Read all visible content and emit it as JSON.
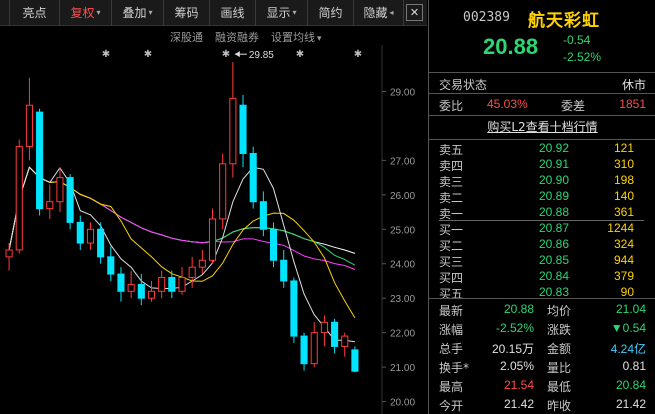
{
  "toolbar": {
    "items": [
      {
        "label": "亮点",
        "caret": ""
      },
      {
        "label": "复权",
        "caret": "▾",
        "active": true
      },
      {
        "label": "叠加",
        "caret": "▾"
      },
      {
        "label": "筹码",
        "caret": ""
      },
      {
        "label": "画线",
        "caret": ""
      },
      {
        "label": "显示",
        "caret": "▾"
      },
      {
        "label": "简约",
        "caret": ""
      },
      {
        "label": "隐藏",
        "caret": "◂"
      }
    ],
    "close_label": "✕"
  },
  "chart_subbar": {
    "shenzhen_connect": "深股通",
    "margin_trading": "融资融券",
    "ma_settings": "设置均线",
    "ma_settings_caret": "▾"
  },
  "chart_data": {
    "type": "candlestick",
    "y_tick_labels": [
      "29.00",
      "27.00",
      "26.00",
      "25.00",
      "24.00",
      "23.00",
      "22.00",
      "21.00",
      "20.00"
    ],
    "high_annotation": "29.85",
    "colors": {
      "up": "#ff3b3b",
      "down": "#00e5ff",
      "ma5": "#e0e0e0",
      "ma10": "#ffd200",
      "ma20": "#ff3bff",
      "ma30": "#2ed573",
      "ma60": "#ffffff"
    },
    "candles": [
      {
        "o": 24.2,
        "h": 24.6,
        "l": 23.8,
        "c": 24.4
      },
      {
        "o": 24.4,
        "h": 27.6,
        "l": 24.3,
        "c": 27.4
      },
      {
        "o": 27.4,
        "h": 29.4,
        "l": 27.0,
        "c": 28.6
      },
      {
        "o": 28.4,
        "h": 28.5,
        "l": 25.4,
        "c": 25.6
      },
      {
        "o": 25.6,
        "h": 26.3,
        "l": 25.3,
        "c": 25.8
      },
      {
        "o": 25.8,
        "h": 26.8,
        "l": 25.5,
        "c": 26.5
      },
      {
        "o": 26.5,
        "h": 26.6,
        "l": 25.0,
        "c": 25.2
      },
      {
        "o": 25.2,
        "h": 25.4,
        "l": 24.4,
        "c": 24.6
      },
      {
        "o": 24.6,
        "h": 25.2,
        "l": 24.4,
        "c": 25.0
      },
      {
        "o": 25.0,
        "h": 25.2,
        "l": 24.0,
        "c": 24.2
      },
      {
        "o": 24.2,
        "h": 24.5,
        "l": 23.5,
        "c": 23.7
      },
      {
        "o": 23.7,
        "h": 23.9,
        "l": 22.9,
        "c": 23.2
      },
      {
        "o": 23.2,
        "h": 23.8,
        "l": 23.0,
        "c": 23.4
      },
      {
        "o": 23.4,
        "h": 23.7,
        "l": 22.8,
        "c": 23.0
      },
      {
        "o": 23.0,
        "h": 23.5,
        "l": 22.9,
        "c": 23.2
      },
      {
        "o": 23.2,
        "h": 23.8,
        "l": 23.0,
        "c": 23.6
      },
      {
        "o": 23.6,
        "h": 23.8,
        "l": 23.0,
        "c": 23.2
      },
      {
        "o": 23.2,
        "h": 23.9,
        "l": 23.1,
        "c": 23.6
      },
      {
        "o": 23.6,
        "h": 24.2,
        "l": 23.3,
        "c": 23.9
      },
      {
        "o": 23.9,
        "h": 24.4,
        "l": 23.7,
        "c": 24.1
      },
      {
        "o": 24.1,
        "h": 25.6,
        "l": 24.0,
        "c": 25.3
      },
      {
        "o": 25.3,
        "h": 27.2,
        "l": 25.0,
        "c": 26.9
      },
      {
        "o": 26.9,
        "h": 29.85,
        "l": 26.5,
        "c": 28.8
      },
      {
        "o": 28.6,
        "h": 28.9,
        "l": 26.8,
        "c": 27.2
      },
      {
        "o": 27.2,
        "h": 27.4,
        "l": 25.6,
        "c": 25.8
      },
      {
        "o": 25.8,
        "h": 26.1,
        "l": 24.8,
        "c": 25.0
      },
      {
        "o": 25.0,
        "h": 25.2,
        "l": 23.9,
        "c": 24.1
      },
      {
        "o": 24.1,
        "h": 24.4,
        "l": 23.3,
        "c": 23.5
      },
      {
        "o": 23.5,
        "h": 23.6,
        "l": 21.7,
        "c": 21.9
      },
      {
        "o": 21.9,
        "h": 22.0,
        "l": 20.9,
        "c": 21.1
      },
      {
        "o": 21.1,
        "h": 22.3,
        "l": 21.0,
        "c": 22.0
      },
      {
        "o": 22.0,
        "h": 22.5,
        "l": 21.6,
        "c": 22.3
      },
      {
        "o": 22.3,
        "h": 22.4,
        "l": 21.4,
        "c": 21.6
      },
      {
        "o": 21.6,
        "h": 22.0,
        "l": 21.3,
        "c": 21.9
      },
      {
        "o": 21.5,
        "h": 21.6,
        "l": 20.85,
        "c": 20.88
      }
    ]
  },
  "quote": {
    "code": "002389",
    "name": "航天彩虹",
    "price": "20.88",
    "change": "-0.54",
    "change_pct": "-2.52%",
    "status_label": "交易状态",
    "status_value": "休市",
    "wei_bi_label": "委比",
    "wei_bi_value": "45.03%",
    "wei_cha_label": "委差",
    "wei_cha_value": "1851",
    "l2_link": "购买L2查看十档行情"
  },
  "order_book": {
    "asks": [
      {
        "label": "卖五",
        "price": "20.92",
        "volume": "121"
      },
      {
        "label": "卖四",
        "price": "20.91",
        "volume": "310"
      },
      {
        "label": "卖三",
        "price": "20.90",
        "volume": "198"
      },
      {
        "label": "卖二",
        "price": "20.89",
        "volume": "140"
      },
      {
        "label": "卖一",
        "price": "20.88",
        "volume": "361"
      }
    ],
    "bids": [
      {
        "label": "买一",
        "price": "20.87",
        "volume": "1244"
      },
      {
        "label": "买二",
        "price": "20.86",
        "volume": "324"
      },
      {
        "label": "买三",
        "price": "20.85",
        "volume": "944"
      },
      {
        "label": "买四",
        "price": "20.84",
        "volume": "379"
      },
      {
        "label": "买五",
        "price": "20.83",
        "volume": "90"
      }
    ]
  },
  "stats": [
    {
      "l1": "最新",
      "v1": "20.88",
      "c1": "g",
      "l2": "均价",
      "v2": "21.04",
      "c2": "g"
    },
    {
      "l1": "涨幅",
      "v1": "-2.52%",
      "c1": "g",
      "l2": "涨跌",
      "v2": "▼0.54",
      "c2": "g"
    },
    {
      "l1": "总手",
      "v1": "20.15万",
      "c1": "w",
      "l2": "金额",
      "v2": "4.24亿",
      "c2": "c"
    },
    {
      "l1": "换手*",
      "v1": "2.05%",
      "c1": "w",
      "l2": "量比",
      "v2": "0.81",
      "c2": "w"
    },
    {
      "l1": "最高",
      "v1": "21.54",
      "c1": "r",
      "l2": "最低",
      "v2": "20.84",
      "c2": "g"
    },
    {
      "l1": "今开",
      "v1": "21.42",
      "c1": "w",
      "l2": "昨收",
      "v2": "21.42",
      "c2": "w"
    }
  ]
}
